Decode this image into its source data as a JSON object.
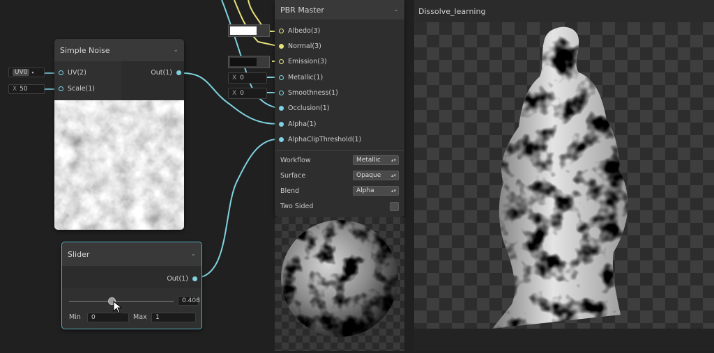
{
  "simple_noise": {
    "title": "Simple Noise",
    "inputs": [
      {
        "label": "UV(2)",
        "value": "UV0"
      },
      {
        "label": "Scale(1)",
        "axis": "X",
        "value": "50"
      }
    ],
    "output": "Out(1)"
  },
  "slider": {
    "title": "Slider",
    "output": "Out(1)",
    "value": "0.408",
    "value_fraction": 0.408,
    "min_label": "Min",
    "min_value": "0",
    "max_label": "Max",
    "max_value": "1"
  },
  "pbr_master": {
    "title": "PBR Master",
    "ports": [
      {
        "label": "Albedo(3)"
      },
      {
        "label": "Normal(3)"
      },
      {
        "label": "Emission(3)"
      },
      {
        "label": "Metallic(1)",
        "axis": "X",
        "value": "0"
      },
      {
        "label": "Smoothness(1)",
        "axis": "X",
        "value": "0"
      },
      {
        "label": "Occlusion(1)"
      },
      {
        "label": "Alpha(1)"
      },
      {
        "label": "AlphaClipThreshold(1)"
      }
    ],
    "settings": [
      {
        "label": "Workflow",
        "value": "Metallic"
      },
      {
        "label": "Surface",
        "value": "Opaque"
      },
      {
        "label": "Blend",
        "value": "Alpha"
      },
      {
        "label": "Two Sided"
      }
    ]
  },
  "preview_window": {
    "title": "Dissolve_learning"
  },
  "colors": {
    "wire_cyan": "#7fd3e0",
    "wire_yellow": "#e8e27a",
    "node_bg": "#2c2c2c",
    "graph_bg": "#202020",
    "albedo_swatch": "#ffffff",
    "emission_swatch": "#111111"
  },
  "icons": [
    "chevron-down-icon",
    "dropdown-arrow-icon",
    "cursor-arrow-icon"
  ]
}
